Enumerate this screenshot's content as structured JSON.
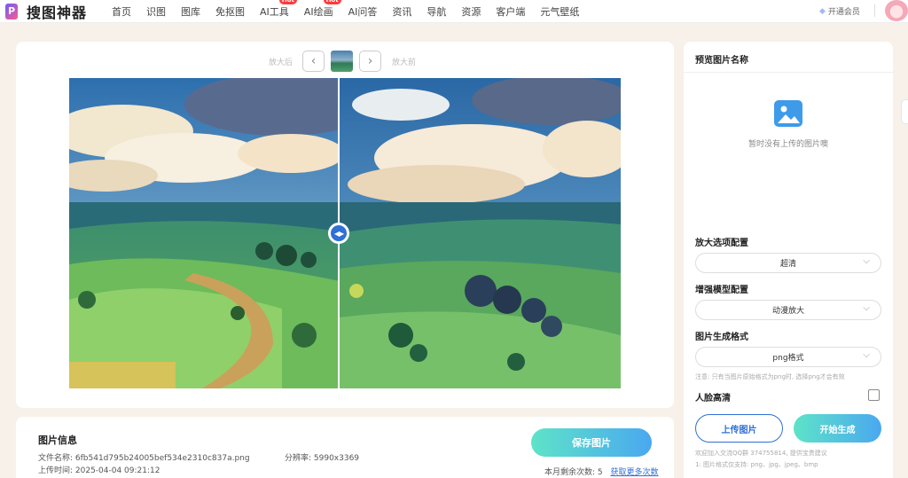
{
  "nav": {
    "logo_mark": "P",
    "logo_text": "搜图神器",
    "items": [
      {
        "label": "首页",
        "hot": ""
      },
      {
        "label": "识图",
        "hot": ""
      },
      {
        "label": "图库",
        "hot": ""
      },
      {
        "label": "免抠图",
        "hot": ""
      },
      {
        "label": "AI工具",
        "hot": "Hot"
      },
      {
        "label": "AI绘画",
        "hot": "Hot"
      },
      {
        "label": "AI问答",
        "hot": ""
      },
      {
        "label": "资讯",
        "hot": ""
      },
      {
        "label": "导航",
        "hot": ""
      },
      {
        "label": "资源",
        "hot": ""
      },
      {
        "label": "客户端",
        "hot": ""
      },
      {
        "label": "元气壁纸",
        "hot": ""
      }
    ],
    "vip_label": "开通会员"
  },
  "compare": {
    "after_label": "放大后",
    "before_label": "放大前",
    "prev_icon": "chevron-left-icon",
    "next_icon": "chevron-right-icon"
  },
  "info": {
    "title": "图片信息",
    "filename": "文件名称: 6fb541d795b24005bef534e2310c837a.png",
    "upload_time": "上传时间: 2025-04-04 09:21:12",
    "resolution": "分辨率: 5990x3369",
    "save_label": "保存图片",
    "quota_text": "本月剩余次数: 5",
    "quota_link": "获取更多次数"
  },
  "side": {
    "preview_title": "预览图片名称",
    "empty_text": "暂时没有上传的图片噢",
    "zoom_title": "放大选项配置",
    "zoom_value": "超清",
    "model_title": "增强模型配置",
    "model_value": "动漫放大",
    "format_title": "图片生成格式",
    "format_value": "png格式",
    "note": "注意: 只有当图片原始格式为png时, 选择png才会有效",
    "face_label": "人脸高清",
    "face_checked": false,
    "upload_label": "上传图片",
    "generate_label": "开始生成",
    "footer_qq": "欢迎加入交流QQ群 374755814, 提供宝贵建议",
    "footer_formats": "1: 图片格式仅支持: png、jpg、jpeg、bmp"
  },
  "colors": {
    "accent": "#2f6fd6",
    "gradient_start": "#5ee3c8",
    "gradient_end": "#4aa8f0",
    "hot": "#ff3b3b"
  }
}
